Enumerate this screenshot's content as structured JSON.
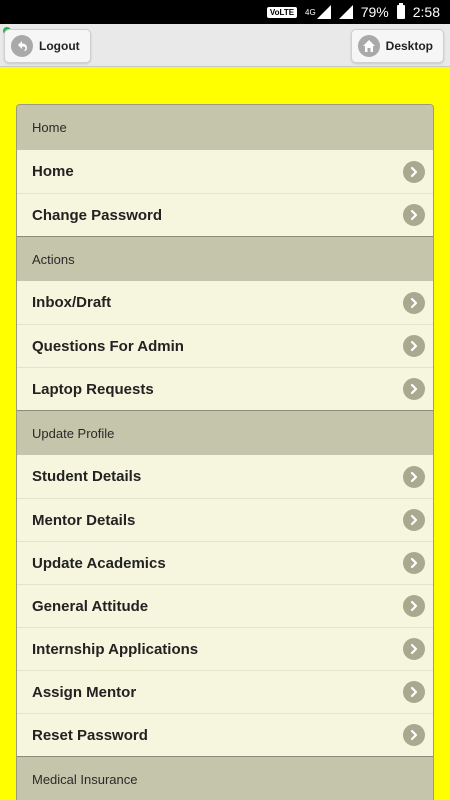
{
  "status_bar": {
    "network": "VoLTE",
    "signal_label": "4G",
    "battery": "79%",
    "time": "2:58"
  },
  "header": {
    "logout_label": "Logout",
    "desktop_label": "Desktop"
  },
  "menu": {
    "sections": [
      {
        "title": "Home",
        "items": [
          "Home",
          "Change Password"
        ]
      },
      {
        "title": "Actions",
        "items": [
          "Inbox/Draft",
          "Questions For Admin",
          "Laptop Requests"
        ]
      },
      {
        "title": "Update Profile",
        "items": [
          "Student Details",
          "Mentor Details",
          "Update Academics",
          "General Attitude",
          "Internship Applications",
          "Assign Mentor",
          "Reset Password"
        ]
      },
      {
        "title": "Medical Insurance",
        "items": []
      }
    ]
  },
  "colors": {
    "page_background": "#ffff00",
    "divider": "#c5c5ab",
    "row": "#f6f6de",
    "arrow": "#a9a98f"
  }
}
